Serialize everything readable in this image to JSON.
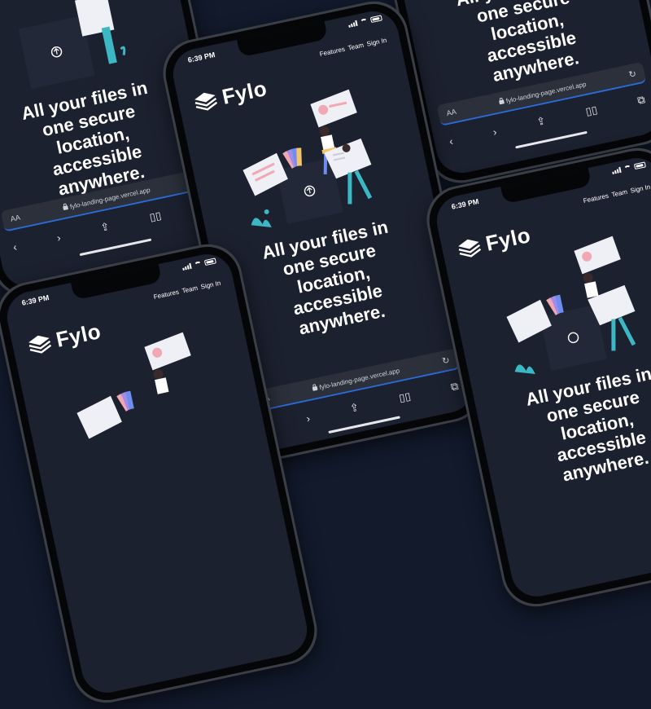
{
  "status": {
    "time": "6:39 PM"
  },
  "nav": {
    "links": [
      "Features",
      "Team",
      "Sign In"
    ]
  },
  "brand": {
    "name": "Fylo"
  },
  "hero": {
    "headline": "All your files in one secure location, accessible anywhere."
  },
  "browser": {
    "text_size_label": "AA",
    "url": "fylo-landing-page.vercel.app",
    "icons": [
      "back-icon",
      "forward-icon",
      "share-icon",
      "bookmarks-icon",
      "tabs-icon",
      "reload-icon",
      "lock-icon"
    ]
  },
  "colors": {
    "background": "#121a2c",
    "screen": "#1c2130",
    "url_bar": "#2b303b",
    "accent_blue": "#2b6bd6",
    "illustration_pink": "#f2a7b5",
    "illustration_teal": "#3cb8c4"
  }
}
